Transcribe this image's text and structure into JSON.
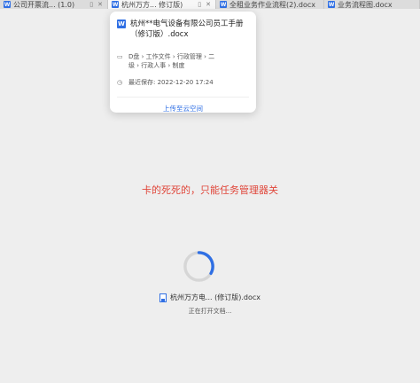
{
  "tabs": [
    {
      "label": "公司开票流... (1.0)",
      "active": false
    },
    {
      "label": "杭州万方... 修订版)",
      "active": true
    },
    {
      "label": "全租业务作业流程(2).docx",
      "active": false
    },
    {
      "label": "业务流程图.docx",
      "active": false
    }
  ],
  "popover": {
    "title": "杭州**电气设备有限公司员工手册（修订版）.docx",
    "path_line1": "D盘 › 工作文件 › 行政管理 › 二",
    "path_line2": "级 › 行政人事 › 制度",
    "saved_label": "最近保存: 2022-12-20 17:24",
    "upload_label": "上传至云空间"
  },
  "annotation": "卡的死死的，只能任务管理器关",
  "loading": {
    "file_name": "杭州万方电... (修订版).docx",
    "status": "正在打开文档..."
  },
  "colors": {
    "accent": "#2f6fe4",
    "annotation": "#e0463a"
  }
}
